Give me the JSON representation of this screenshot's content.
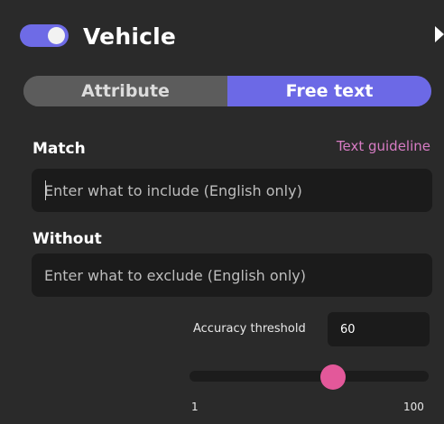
{
  "header": {
    "enabled": true,
    "title": "Vehicle"
  },
  "tabs": [
    {
      "label": "Attribute",
      "active": false
    },
    {
      "label": "Free text",
      "active": true
    }
  ],
  "match": {
    "label": "Match",
    "guideline_link": "Text guideline",
    "placeholder": "Enter what to include (English only)",
    "value": ""
  },
  "without": {
    "label": "Without",
    "placeholder": "Enter what to exclude (English only)",
    "value": ""
  },
  "threshold": {
    "label": "Accuracy threshold",
    "value": "60",
    "min": 1,
    "max": 100,
    "min_label": "1",
    "max_label": "100"
  },
  "colors": {
    "accent": "#6c69e6",
    "slider_thumb": "#e3589a",
    "link": "#d77cc4",
    "background": "#2a2a2a"
  }
}
